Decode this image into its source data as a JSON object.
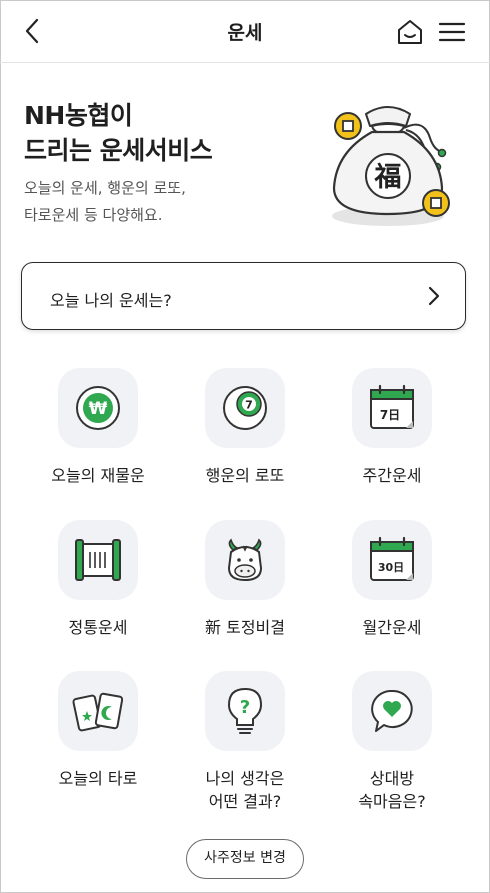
{
  "header": {
    "title": "운세"
  },
  "hero": {
    "title_line1": "NH농협이",
    "title_line2": "드리는 운세서비스",
    "sub_line1": "오늘의 운세, 행운의 로또,",
    "sub_line2": "타로운세 등 다양해요.",
    "bag_glyph": "福"
  },
  "fortune_button": {
    "label": "오늘 나의 운세는?"
  },
  "tiles": [
    {
      "label": "오늘의 재물운",
      "icon": "won-coin-icon",
      "glyph": "₩"
    },
    {
      "label": "행운의 로또",
      "icon": "lotto-ball-icon",
      "glyph": "7"
    },
    {
      "label": "주간운세",
      "icon": "weekly-calendar-icon",
      "glyph": "7日"
    },
    {
      "label": "정통운세",
      "icon": "scroll-icon"
    },
    {
      "label": "新 토정비결",
      "icon": "ox-icon"
    },
    {
      "label": "월간운세",
      "icon": "monthly-calendar-icon",
      "glyph": "30日"
    },
    {
      "label": "오늘의 타로",
      "icon": "tarot-cards-icon"
    },
    {
      "label_line1": "나의 생각은",
      "label_line2": "어떤 결과?",
      "icon": "lightbulb-icon",
      "glyph": "?"
    },
    {
      "label_line1": "상대방",
      "label_line2": "속마음은?",
      "icon": "heart-bubble-icon"
    }
  ],
  "saju_button": {
    "label": "사주정보 변경"
  },
  "colors": {
    "accent_green": "#2fa84f",
    "tile_bg": "#f1f2f5",
    "gold": "#f2c21b"
  }
}
